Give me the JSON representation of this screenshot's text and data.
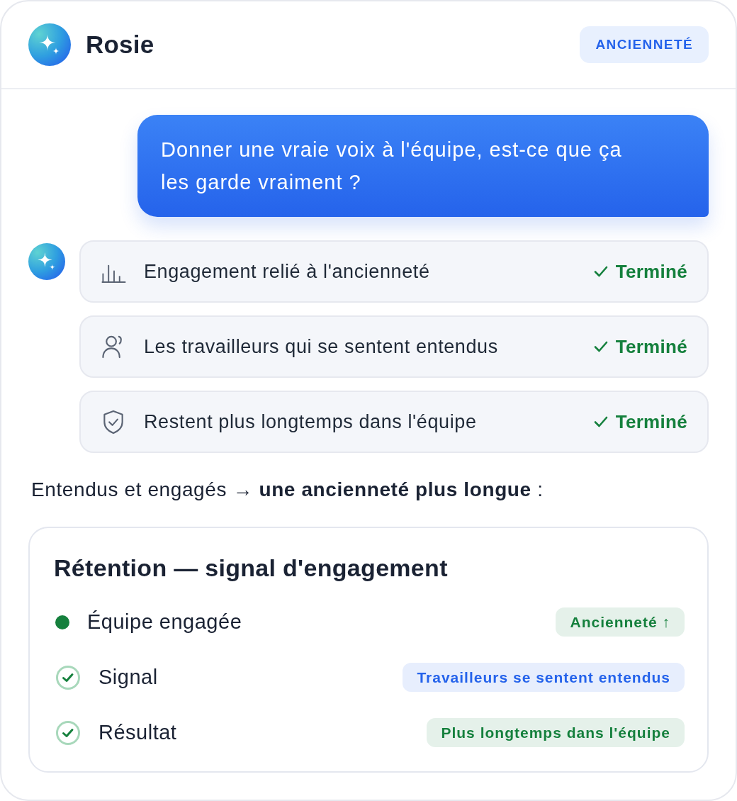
{
  "header": {
    "name": "Rosie",
    "badge": "ANCIENNETÉ"
  },
  "user_message": {
    "text": "Donner une vraie voix à l'équipe, est-ce que ça les garde vraiment ?"
  },
  "steps": [
    {
      "label": "Engagement relié à l'ancienneté",
      "status": "Terminé"
    },
    {
      "label": "Les travailleurs qui se sentent entendus",
      "status": "Terminé"
    },
    {
      "label": "Restent plus longtemps dans l'équipe",
      "status": "Terminé"
    }
  ],
  "summary": "Entendus et engagés → **une ancienneté plus longue** :",
  "retention_card": {
    "title": "Rétention — signal d'engagement",
    "rows": [
      {
        "kind": "dot",
        "color": "#15803d",
        "label": "Équipe engagée",
        "tag": {
          "text": "Ancienneté ↑",
          "color": "#15803d"
        }
      },
      {
        "kind": "check",
        "label": "Signal",
        "tag": {
          "text": "Travailleurs se sentent entendus",
          "color": "#2563eb"
        }
      },
      {
        "kind": "check",
        "label": "Résultat",
        "tag": {
          "text": "Plus longtemps dans l'équipe",
          "color": "#15803d"
        }
      }
    ]
  }
}
